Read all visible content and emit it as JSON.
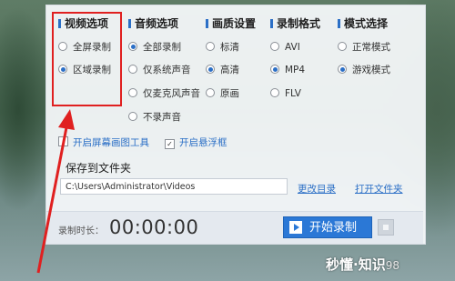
{
  "columns": [
    {
      "title": "视频选项",
      "options": [
        {
          "label": "全屏录制",
          "selected": false
        },
        {
          "label": "区域录制",
          "selected": true
        }
      ]
    },
    {
      "title": "音频选项",
      "options": [
        {
          "label": "全部录制",
          "selected": true
        },
        {
          "label": "仅系统声音",
          "selected": false
        },
        {
          "label": "仅麦克风声音",
          "selected": false
        },
        {
          "label": "不录声音",
          "selected": false
        }
      ]
    },
    {
      "title": "画质设置",
      "options": [
        {
          "label": "标清",
          "selected": false
        },
        {
          "label": "高清",
          "selected": true
        },
        {
          "label": "原画",
          "selected": false
        }
      ]
    },
    {
      "title": "录制格式",
      "options": [
        {
          "label": "AVI",
          "selected": false
        },
        {
          "label": "MP4",
          "selected": true
        },
        {
          "label": "FLV",
          "selected": false
        }
      ]
    },
    {
      "title": "模式选择",
      "options": [
        {
          "label": "正常模式",
          "selected": false
        },
        {
          "label": "游戏模式",
          "selected": true
        }
      ]
    }
  ],
  "toggles": {
    "screen_tool": {
      "label": "开启屏幕画图工具",
      "checked": false
    },
    "float_window": {
      "label": "开启悬浮框",
      "checked": true
    }
  },
  "save": {
    "title": "保存到文件夹",
    "path": "C:\\Users\\Administrator\\Videos",
    "change_dir": "更改目录",
    "open_folder": "打开文件夹"
  },
  "recording": {
    "duration_label": "录制时长：",
    "timer": "00:00:00",
    "start_label": "开始录制"
  },
  "watermark": {
    "text": "秒懂·知识",
    "suffix": "98"
  },
  "colors": {
    "accent": "#2b6fc6",
    "highlight": "#e02020"
  }
}
